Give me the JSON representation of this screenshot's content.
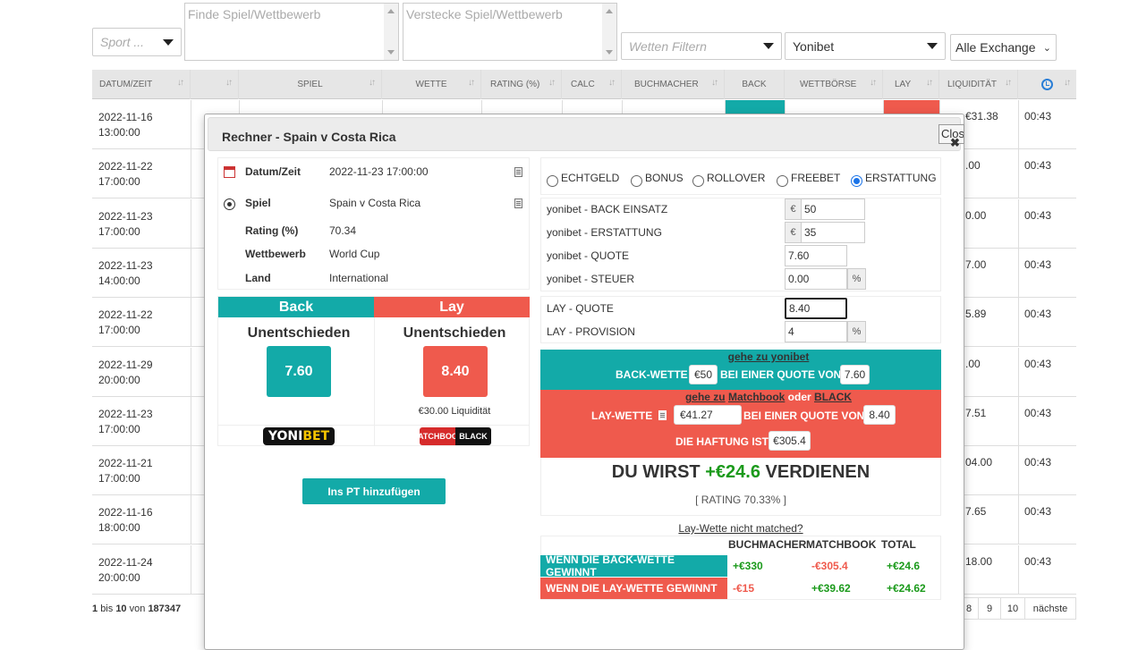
{
  "filters": {
    "sport_placeholder": "Sport ...",
    "find_placeholder": "Finde Spiel/Wettbewerb",
    "hide_placeholder": "Verstecke Spiel/Wettbewerb",
    "bet_filter_placeholder": "Wetten Filtern",
    "bookmaker_value": "Yonibet",
    "exchange_value": "Alle Exchange"
  },
  "table": {
    "headers": [
      "DATUM/ZEIT",
      "",
      "SPIEL",
      "WETTE",
      "RATING (%)",
      "CALC",
      "BUCHMACHER",
      "BACK",
      "WETTBÖRSE",
      "LAY",
      "LIQUIDITÄT",
      ""
    ],
    "rows": [
      {
        "date": "2022-11-16",
        "time_of_day": "13:00:00",
        "liquidity": "€31.38",
        "age": "00:43"
      },
      {
        "date": "2022-11-22",
        "time_of_day": "17:00:00",
        "liquidity": ".00",
        "age": "00:43"
      },
      {
        "date": "2022-11-23",
        "time_of_day": "17:00:00",
        "liquidity": "0.00",
        "age": "00:43"
      },
      {
        "date": "2022-11-23",
        "time_of_day": "14:00:00",
        "liquidity": "7.00",
        "age": "00:43"
      },
      {
        "date": "2022-11-22",
        "time_of_day": "17:00:00",
        "liquidity": "5.89",
        "age": "00:43"
      },
      {
        "date": "2022-11-29",
        "time_of_day": "20:00:00",
        "liquidity": ".00",
        "age": "00:43"
      },
      {
        "date": "2022-11-23",
        "time_of_day": "17:00:00",
        "liquidity": "7.51",
        "age": "00:43"
      },
      {
        "date": "2022-11-21",
        "time_of_day": "17:00:00",
        "liquidity": "04.00",
        "age": "00:43"
      },
      {
        "date": "2022-11-16",
        "time_of_day": "18:00:00",
        "liquidity": "7.65",
        "age": "00:43"
      },
      {
        "date": "2022-11-24",
        "time_of_day": "20:00:00",
        "liquidity": "18.00",
        "age": "00:43"
      }
    ],
    "pageinfo": {
      "from": "1",
      "bis": "bis",
      "to": "10",
      "von": "von",
      "total": "187347"
    },
    "pager": [
      "8",
      "9",
      "10",
      "nächste"
    ]
  },
  "modal": {
    "title": "Rechner - Spain v Costa Rica",
    "close_label": "Close",
    "close_x": "✖",
    "info": {
      "datetime_label": "Datum/Zeit",
      "datetime_value": "2022-11-23 17:00:00",
      "match_label": "Spiel",
      "match_value": "Spain v Costa Rica",
      "rating_label": "Rating (%)",
      "rating_value": "70.34",
      "competition_label": "Wettbewerb",
      "competition_value": "World Cup",
      "country_label": "Land",
      "country_value": "International"
    },
    "back": {
      "header": "Back",
      "selection": "Unentschieden",
      "odds": "7.60",
      "logo_a": "YONI",
      "logo_b": "BET"
    },
    "lay": {
      "header": "Lay",
      "selection": "Unentschieden",
      "odds": "8.40",
      "liquidity": "€30.00 Liquidität",
      "logo_a": "MATCHBOOK",
      "logo_b": "BLACK"
    },
    "add_button": "Ins PT hinzufügen",
    "modes": [
      {
        "label": "ECHTGELD",
        "checked": false
      },
      {
        "label": "BONUS",
        "checked": false
      },
      {
        "label": "ROLLOVER",
        "checked": false
      },
      {
        "label": "FREEBET",
        "checked": false
      },
      {
        "label": "ERSTATTUNG",
        "checked": true
      }
    ],
    "calc": {
      "back_stake_label": "yonibet - BACK EINSATZ",
      "back_stake_value": "50",
      "refund_label": "yonibet - ERSTATTUNG",
      "refund_value": "35",
      "odds_label": "yonibet - QUOTE",
      "odds_value": "7.60",
      "tax_label": "yonibet - STEUER",
      "tax_value": "0.00",
      "lay_odds_label": "LAY - QUOTE",
      "lay_odds_value": "8.40",
      "commission_label": "LAY - PROVISION",
      "commission_value": "4",
      "currency": "€",
      "percent": "%"
    },
    "result": {
      "goto_back": "gehe zu yonibet",
      "back_bet_label": "BACK-WETTE",
      "back_stake": "€50",
      "at_odds_label": "BEI EINER QUOTE VON",
      "back_odds": "7.60",
      "goto_lay_prefix": "gehe zu",
      "goto_lay_a": "Matchbook",
      "goto_lay_or": "oder",
      "goto_lay_b": "BLACK",
      "lay_bet_label": "LAY-WETTE",
      "lay_stake": "€41.27",
      "lay_odds": "8.40",
      "liability_label": "DIE HAFTUNG IST",
      "liability": "€305.4",
      "earn_prefix": "DU WIRST",
      "earn_value": "+€24.6",
      "earn_suffix": "VERDIENEN",
      "rating_line": "[ RATING 70.33% ]",
      "unmatched": "Lay-Wette nicht matched?"
    },
    "summary": {
      "headers": [
        "BUCHMACHER",
        "MATCHBOOK",
        "TOTAL"
      ],
      "back_wins_label": "WENN DIE BACK-WETTE GEWINNT",
      "back_wins": [
        "+€330",
        "-€305.4",
        "+€24.6"
      ],
      "lay_wins_label": "WENN DIE LAY-WETTE GEWINNT",
      "lay_wins": [
        "-€15",
        "+€39.62",
        "+€24.62"
      ]
    }
  },
  "colors": {
    "teal": "#13aaa8",
    "red": "#ef5a4d",
    "green": "#1b9a1b"
  }
}
